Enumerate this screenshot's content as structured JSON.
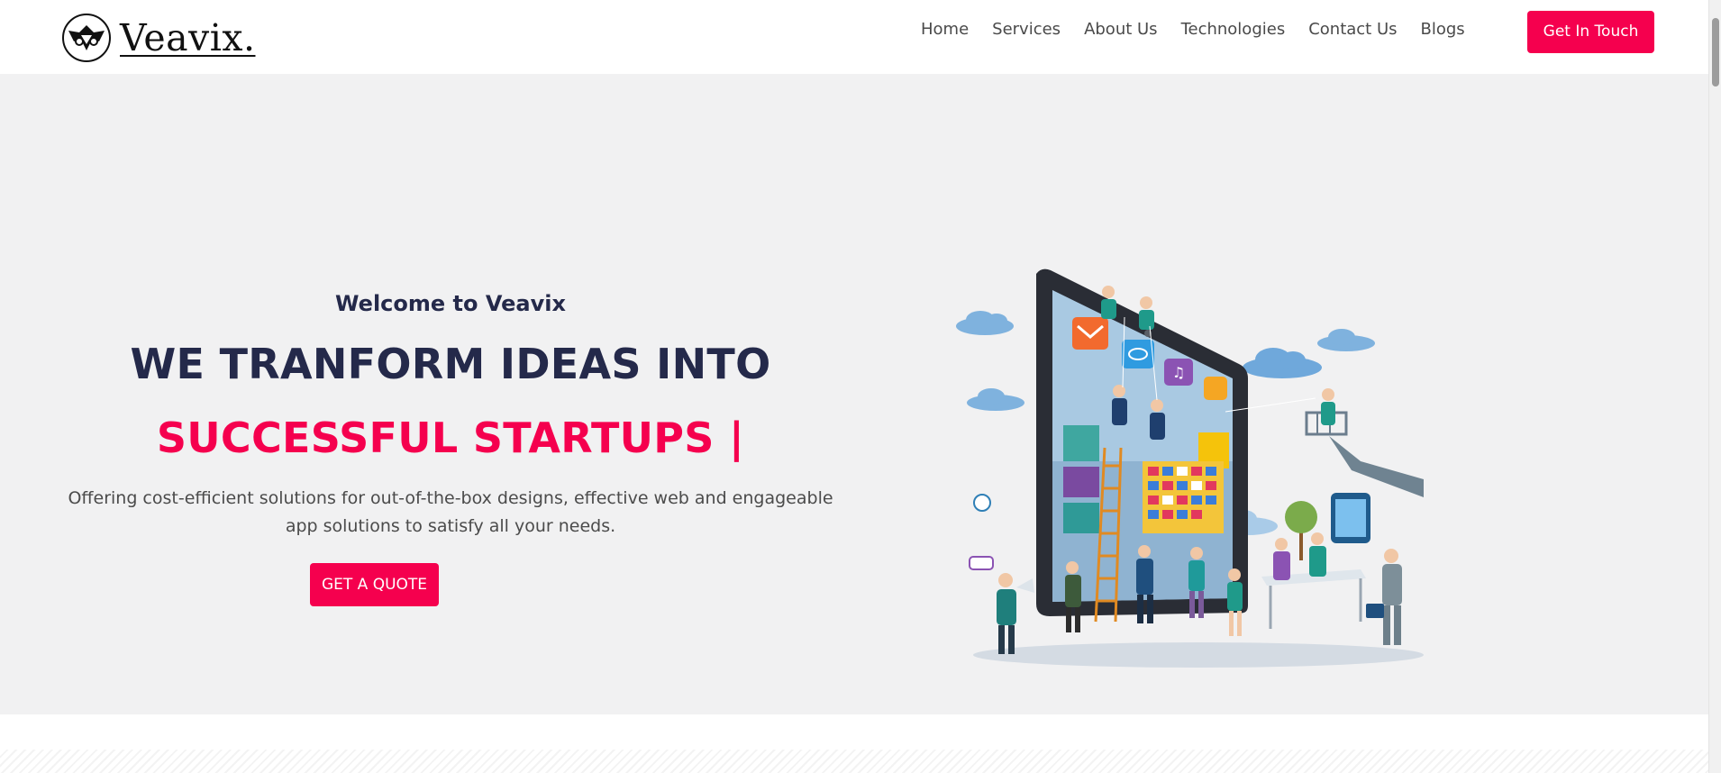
{
  "brand": {
    "logo_text": "Veavix.",
    "logo_icon": "veavix-wing-emblem-icon",
    "accent_color": "#f5004e",
    "heading_color": "#24294a",
    "hero_background": "#f1f1f2"
  },
  "nav": {
    "items": [
      {
        "label": "Home"
      },
      {
        "label": "Services"
      },
      {
        "label": "About Us"
      },
      {
        "label": "Technologies"
      },
      {
        "label": "Contact Us"
      },
      {
        "label": "Blogs"
      }
    ],
    "cta_label": "Get In Touch"
  },
  "hero": {
    "welcome": "Welcome to Veavix",
    "headline_line1": "WE TRANFORM IDEAS INTO",
    "headline_line2": "SUCCESSFUL STARTUPS |",
    "description": "Offering cost-efficient solutions for out-of-the-box designs, effective web and engageable app solutions to satisfy all your needs.",
    "cta_label": "GET A QUOTE",
    "illustration_icon": "tablet-app-team-illustration-icon"
  }
}
